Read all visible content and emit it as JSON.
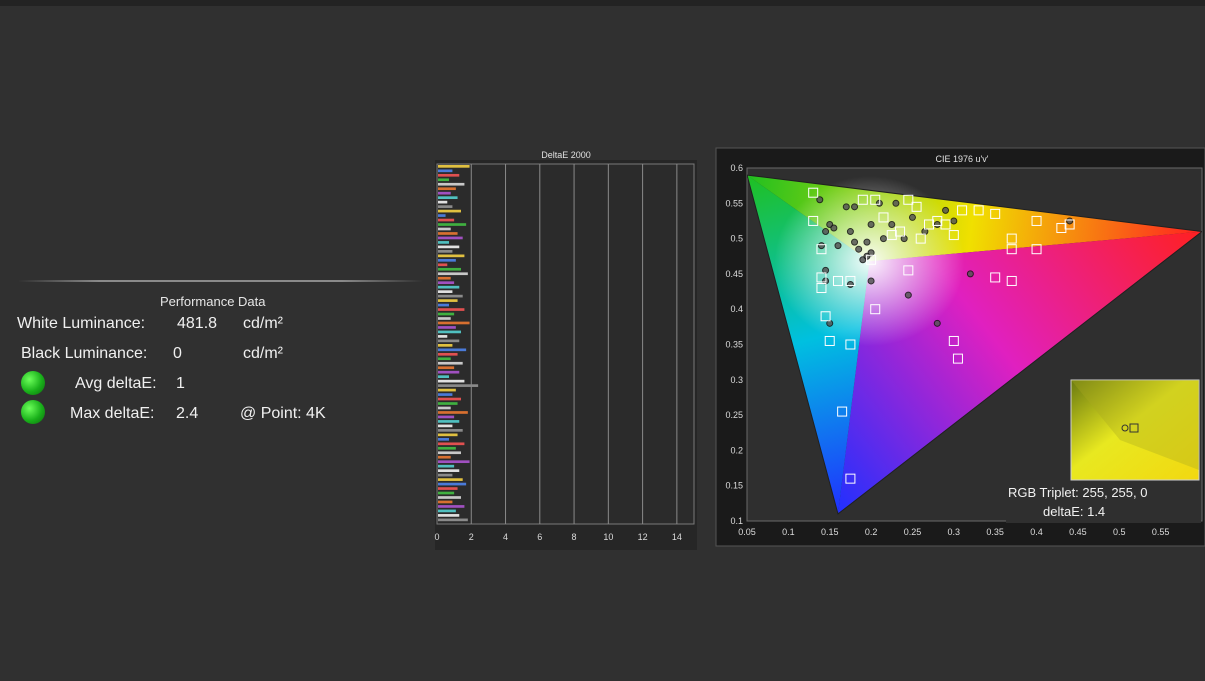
{
  "performance": {
    "title": "Performance Data",
    "white_label": "White Luminance:",
    "white_value": "481.8",
    "white_unit": "cd/m²",
    "black_label": "Black Luminance:",
    "black_value": "0",
    "black_unit": "cd/m²",
    "avg_label": "Avg deltaE:",
    "avg_value": "1",
    "max_label": "Max deltaE:",
    "max_value": "2.4",
    "point_label": "@ Point: 4K",
    "status_color": "#22c022"
  },
  "chart_data": [
    {
      "type": "bar",
      "orientation": "horizontal",
      "title": "DeltaE 2000",
      "xlim": [
        0,
        15
      ],
      "xticks": [
        "0",
        "2",
        "4",
        "6",
        "8",
        "10",
        "12",
        "14"
      ],
      "grid": true,
      "values": [
        1.9,
        0.9,
        1.3,
        0.7,
        1.6,
        1.1,
        0.8,
        1.2,
        0.6,
        0.9,
        1.4,
        0.5,
        1.0,
        1.7,
        0.8,
        1.2,
        1.5,
        0.7,
        1.3,
        0.9,
        1.6,
        1.1,
        0.6,
        1.4,
        1.8,
        0.8,
        1.0,
        1.3,
        0.9,
        1.5,
        1.2,
        0.7,
        1.6,
        1.0,
        0.8,
        1.9,
        1.1,
        1.4,
        0.6,
        1.3,
        0.9,
        1.7,
        1.2,
        0.8,
        1.5,
        1.0,
        1.3,
        0.7,
        1.6,
        2.4,
        1.1,
        0.9,
        1.4,
        1.2,
        0.8,
        1.8,
        1.0,
        1.3,
        0.9,
        1.5,
        1.2,
        0.7,
        1.6,
        1.1,
        1.4,
        0.8,
        1.9,
        1.0,
        1.3,
        0.9,
        1.5,
        1.7,
        1.2,
        1.0,
        1.4,
        0.9,
        1.6,
        1.1,
        1.3,
        1.8
      ],
      "bar_colors": [
        "#e0c040",
        "#4a7ad8",
        "#e05050",
        "#40b040",
        "#c8c8c8",
        "#d87030",
        "#a050c0",
        "#50c0c0",
        "#e0e0e0",
        "#8a8a8a"
      ]
    },
    {
      "type": "scatter",
      "title": "CIE 1976 u'v'",
      "xlim": [
        0.05,
        0.6
      ],
      "ylim": [
        0.1,
        0.6
      ],
      "xticks": [
        "0.05",
        "0.1",
        "0.15",
        "0.2",
        "0.25",
        "0.3",
        "0.35",
        "0.4",
        "0.45",
        "0.5",
        "0.55"
      ],
      "yticks": [
        "0.1",
        "0.15",
        "0.2",
        "0.25",
        "0.3",
        "0.35",
        "0.4",
        "0.45",
        "0.5",
        "0.55",
        "0.6"
      ],
      "gamut_primaries": {
        "red": [
          0.6,
          0.51
        ],
        "green": [
          0.05,
          0.59
        ],
        "blue": [
          0.16,
          0.11
        ]
      },
      "targets": [
        [
          0.13,
          0.565
        ],
        [
          0.13,
          0.525
        ],
        [
          0.14,
          0.485
        ],
        [
          0.14,
          0.445
        ],
        [
          0.14,
          0.43
        ],
        [
          0.145,
          0.39
        ],
        [
          0.15,
          0.355
        ],
        [
          0.16,
          0.44
        ],
        [
          0.175,
          0.44
        ],
        [
          0.175,
          0.35
        ],
        [
          0.165,
          0.255
        ],
        [
          0.175,
          0.16
        ],
        [
          0.19,
          0.555
        ],
        [
          0.205,
          0.555
        ],
        [
          0.215,
          0.53
        ],
        [
          0.225,
          0.505
        ],
        [
          0.235,
          0.51
        ],
        [
          0.245,
          0.555
        ],
        [
          0.255,
          0.545
        ],
        [
          0.26,
          0.5
        ],
        [
          0.27,
          0.52
        ],
        [
          0.28,
          0.525
        ],
        [
          0.29,
          0.52
        ],
        [
          0.3,
          0.505
        ],
        [
          0.31,
          0.54
        ],
        [
          0.33,
          0.54
        ],
        [
          0.35,
          0.535
        ],
        [
          0.37,
          0.5
        ],
        [
          0.37,
          0.485
        ],
        [
          0.35,
          0.445
        ],
        [
          0.37,
          0.44
        ],
        [
          0.4,
          0.485
        ],
        [
          0.4,
          0.525
        ],
        [
          0.43,
          0.515
        ],
        [
          0.44,
          0.52
        ],
        [
          0.245,
          0.455
        ],
        [
          0.205,
          0.4
        ],
        [
          0.3,
          0.355
        ],
        [
          0.305,
          0.33
        ],
        [
          0.2,
          0.47
        ]
      ],
      "measured": [
        [
          0.138,
          0.555
        ],
        [
          0.145,
          0.51
        ],
        [
          0.15,
          0.52
        ],
        [
          0.14,
          0.49
        ],
        [
          0.145,
          0.455
        ],
        [
          0.155,
          0.515
        ],
        [
          0.16,
          0.49
        ],
        [
          0.17,
          0.545
        ],
        [
          0.175,
          0.51
        ],
        [
          0.18,
          0.495
        ],
        [
          0.18,
          0.545
        ],
        [
          0.185,
          0.485
        ],
        [
          0.19,
          0.47
        ],
        [
          0.195,
          0.495
        ],
        [
          0.2,
          0.52
        ],
        [
          0.2,
          0.48
        ],
        [
          0.21,
          0.55
        ],
        [
          0.215,
          0.5
        ],
        [
          0.225,
          0.52
        ],
        [
          0.23,
          0.55
        ],
        [
          0.24,
          0.5
        ],
        [
          0.25,
          0.53
        ],
        [
          0.265,
          0.51
        ],
        [
          0.28,
          0.52
        ],
        [
          0.29,
          0.54
        ],
        [
          0.3,
          0.525
        ],
        [
          0.32,
          0.45
        ],
        [
          0.28,
          0.38
        ],
        [
          0.245,
          0.42
        ],
        [
          0.2,
          0.44
        ],
        [
          0.175,
          0.435
        ],
        [
          0.15,
          0.38
        ],
        [
          0.44,
          0.525
        ],
        [
          0.145,
          0.44
        ],
        [
          0.195,
          0.475
        ]
      ],
      "inset": {
        "triplet_label": "RGB Triplet: 255, 255, 0",
        "deltae_label": "deltaE: 1.4"
      }
    }
  ]
}
